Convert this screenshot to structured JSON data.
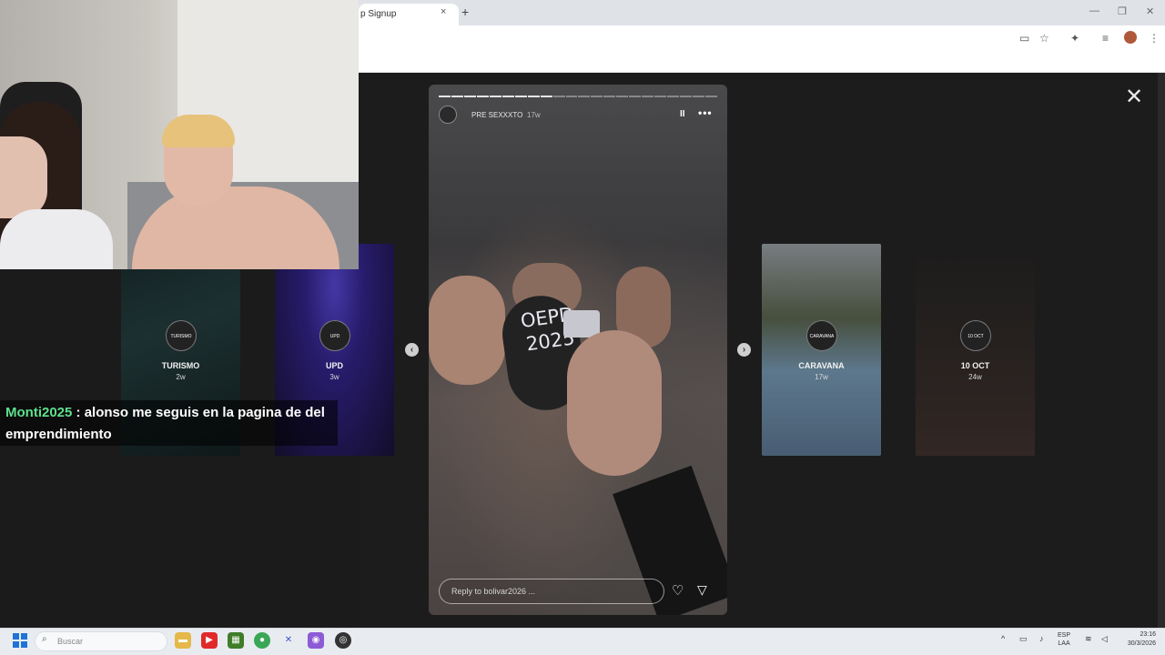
{
  "browser": {
    "tab_title": "p Signup",
    "tab_close": "×",
    "new_tab": "+",
    "window_min": "—",
    "window_max": "❐",
    "window_close": "✕"
  },
  "viewer": {
    "close": "✕",
    "prev": "‹",
    "next": "›"
  },
  "thumbnails": [
    {
      "name": "TURISMO",
      "age": "2w",
      "avatar_text": "TURISMO"
    },
    {
      "name": "UPD",
      "age": "3w",
      "avatar_text": "UPD"
    },
    {
      "name": "CARAVANA",
      "age": "17w",
      "avatar_text": "CARAVANA"
    },
    {
      "name": "10 OCT",
      "age": "24w",
      "avatar_text": "10 OCT"
    }
  ],
  "story": {
    "username": "PRE SEXXXTO",
    "age": "17w",
    "pause": "II",
    "more": "•••",
    "sign_text": "OEPD 2025",
    "reply_placeholder": "Reply to bolivar2026 ...",
    "heart": "♡",
    "send": "▽",
    "progress_segments": 22,
    "progress_done": 9
  },
  "chat": {
    "user": "Monti2025",
    "message": " : alonso me seguis en la pagina de del emprendimiento"
  },
  "taskbar": {
    "search_placeholder": "Buscar",
    "search_icon": "⌕",
    "tray": "^",
    "lang_line1": "ESP",
    "lang_line2": "LAA",
    "time": "23:16",
    "date": "30/3/2026"
  },
  "colors": {
    "chat_user": "#5fe08d",
    "overlay_bg": "#1c1c1c",
    "taskbar_bg": "#e8ecf0"
  }
}
